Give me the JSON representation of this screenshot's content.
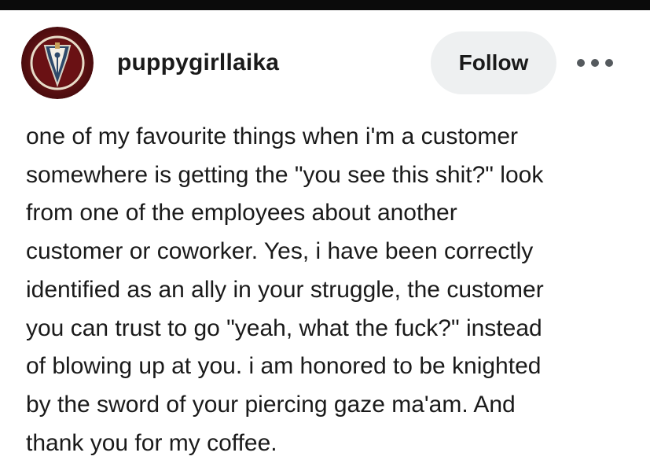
{
  "header": {
    "username": "puppygirllaika",
    "follow_label": "Follow",
    "avatar_icon": "fountain-pen-nib-icon",
    "more_icon": "more-options-icon"
  },
  "post": {
    "lines": [
      "one of my favourite things when i'm a customer",
      "somewhere is getting the \"you see this shit?\" look",
      "from one of the employees about another",
      "customer or coworker. Yes, i have been correctly",
      "identified as an ally in your struggle, the customer",
      "you can trust to go \"yeah, what the fuck?\" instead",
      "of blowing up at you. i am honored to be knighted",
      "by the sword of your piercing gaze ma'am. And",
      "thank you for my coffee."
    ]
  },
  "colors": {
    "avatar_background": "#7a1518",
    "avatar_ring": "#e8dcc8",
    "nib_color": "#2e4a6b",
    "follow_bg": "#eef0f1",
    "text": "#1a1a1a"
  }
}
